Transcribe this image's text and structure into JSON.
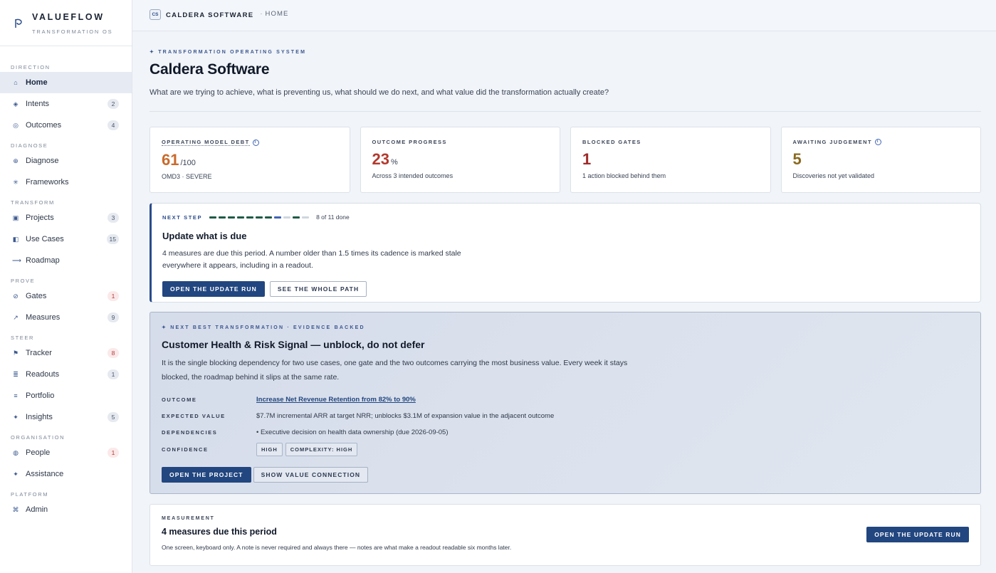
{
  "brand": {
    "name": "VALUEFLOW",
    "subtitle": "TRANSFORMATION OS"
  },
  "sidebar": {
    "sections": [
      {
        "title": "DIRECTION",
        "items": [
          {
            "label": "Home",
            "icon": "home-icon",
            "glyph": "⌂",
            "badge": "",
            "active": true
          },
          {
            "label": "Intents",
            "icon": "diamond-icon",
            "glyph": "◈",
            "badge": "2"
          },
          {
            "label": "Outcomes",
            "icon": "target-icon",
            "glyph": "◎",
            "badge": "4"
          }
        ]
      },
      {
        "title": "DIAGNOSE",
        "items": [
          {
            "label": "Diagnose",
            "icon": "crosshair-icon",
            "glyph": "⊕",
            "badge": ""
          },
          {
            "label": "Frameworks",
            "icon": "asterisk-icon",
            "glyph": "✳",
            "badge": ""
          }
        ]
      },
      {
        "title": "TRANSFORM",
        "items": [
          {
            "label": "Projects",
            "icon": "square-icon",
            "glyph": "▣",
            "badge": "3"
          },
          {
            "label": "Use Cases",
            "icon": "half-square-icon",
            "glyph": "◧",
            "badge": "15"
          },
          {
            "label": "Roadmap",
            "icon": "arrow-right-icon",
            "glyph": "⟶",
            "badge": ""
          }
        ]
      },
      {
        "title": "PROVE",
        "items": [
          {
            "label": "Gates",
            "icon": "gauge-icon",
            "glyph": "⊘",
            "badge": "1",
            "badge_style": "red"
          },
          {
            "label": "Measures",
            "icon": "trend-icon",
            "glyph": "↗",
            "badge": "9"
          }
        ]
      },
      {
        "title": "STEER",
        "items": [
          {
            "label": "Tracker",
            "icon": "flag-icon",
            "glyph": "⚑",
            "badge": "8",
            "badge_style": "red"
          },
          {
            "label": "Readouts",
            "icon": "list-icon",
            "glyph": "≣",
            "badge": "1"
          },
          {
            "label": "Portfolio",
            "icon": "stack-icon",
            "glyph": "≡",
            "badge": ""
          },
          {
            "label": "Insights",
            "icon": "sparkle-icon",
            "glyph": "✦",
            "badge": "5"
          }
        ]
      },
      {
        "title": "ORGANISATION",
        "items": [
          {
            "label": "People",
            "icon": "people-icon",
            "glyph": "◍",
            "badge": "1",
            "badge_style": "red"
          },
          {
            "label": "Assistance",
            "icon": "star-icon",
            "glyph": "✦",
            "badge": ""
          }
        ]
      },
      {
        "title": "PLATFORM",
        "items": [
          {
            "label": "Admin",
            "icon": "command-icon",
            "glyph": "⌘",
            "badge": ""
          }
        ]
      }
    ]
  },
  "topbar": {
    "chip": "CS",
    "company": "CALDERA SOFTWARE",
    "separator": "·",
    "crumb": "HOME"
  },
  "header": {
    "eyebrow": "✦ TRANSFORMATION OPERATING SYSTEM",
    "title": "Caldera Software",
    "subtitle": "What are we trying to achieve, what is preventing us, what should we do next, and what value did the transformation actually create?"
  },
  "kpis": [
    {
      "label": "OPERATING MODEL DEBT",
      "info": true,
      "dotted": true,
      "value": "61",
      "unit": "/100",
      "note": "OMD3 · SEVERE",
      "color": "#c96a2b"
    },
    {
      "label": "OUTCOME PROGRESS",
      "info": false,
      "dotted": false,
      "value": "23",
      "unit": "%",
      "note": "Across 3 intended outcomes",
      "color": "#b23a2e"
    },
    {
      "label": "BLOCKED GATES",
      "info": false,
      "dotted": false,
      "value": "1",
      "unit": "",
      "note": "1 action blocked behind them",
      "color": "#9e2a2a"
    },
    {
      "label": "AWAITING JUDGEMENT",
      "info": true,
      "dotted": false,
      "value": "5",
      "unit": "",
      "note": "Discoveries not yet validated",
      "color": "#8a6a1f"
    }
  ],
  "next_step": {
    "label": "NEXT STEP",
    "progress": {
      "done": 8,
      "total": 11,
      "text": "8 of 11 done"
    },
    "title": "Update what is due",
    "description": "4 measures are due this period. A number older than 1.5 times its cadence is marked stale everywhere it appears, including in a readout.",
    "primary": "OPEN THE UPDATE RUN",
    "secondary": "SEE THE WHOLE PATH"
  },
  "nbt": {
    "eyebrow": "✦ NEXT BEST TRANSFORMATION · EVIDENCE BACKED",
    "title": "Customer Health & Risk Signal — unblock, do not defer",
    "description": "It is the single blocking dependency for two use cases, one gate and the two outcomes carrying the most business value. Every week it stays blocked, the roadmap behind it slips at the same rate.",
    "rows": {
      "outcome_key": "OUTCOME",
      "outcome_val": "Increase Net Revenue Retention from 82% to 90%",
      "value_key": "EXPECTED VALUE",
      "value_val": "$7.7M incremental ARR at target NRR; unblocks $3.1M of expansion value in the adjacent outcome",
      "deps_key": "DEPENDENCIES",
      "deps_val": "• Executive decision on health data ownership (due 2026-09-05)",
      "conf_key": "CONFIDENCE",
      "conf_chip1": "HIGH",
      "conf_chip2": "COMPLEXITY: HIGH"
    },
    "primary": "OPEN THE PROJECT",
    "secondary": "SHOW VALUE CONNECTION"
  },
  "measurement": {
    "eyebrow": "MEASUREMENT",
    "title": "4 measures due this period",
    "description": "One screen, keyboard only. A note is never required and always there — notes are what make a readout readable six months later.",
    "button": "OPEN THE UPDATE RUN"
  },
  "colors": {
    "accent": "#22467f",
    "progress_done": "#1f5a45",
    "progress_current": "#3f64b5",
    "progress_todo": "#cfd6df"
  }
}
